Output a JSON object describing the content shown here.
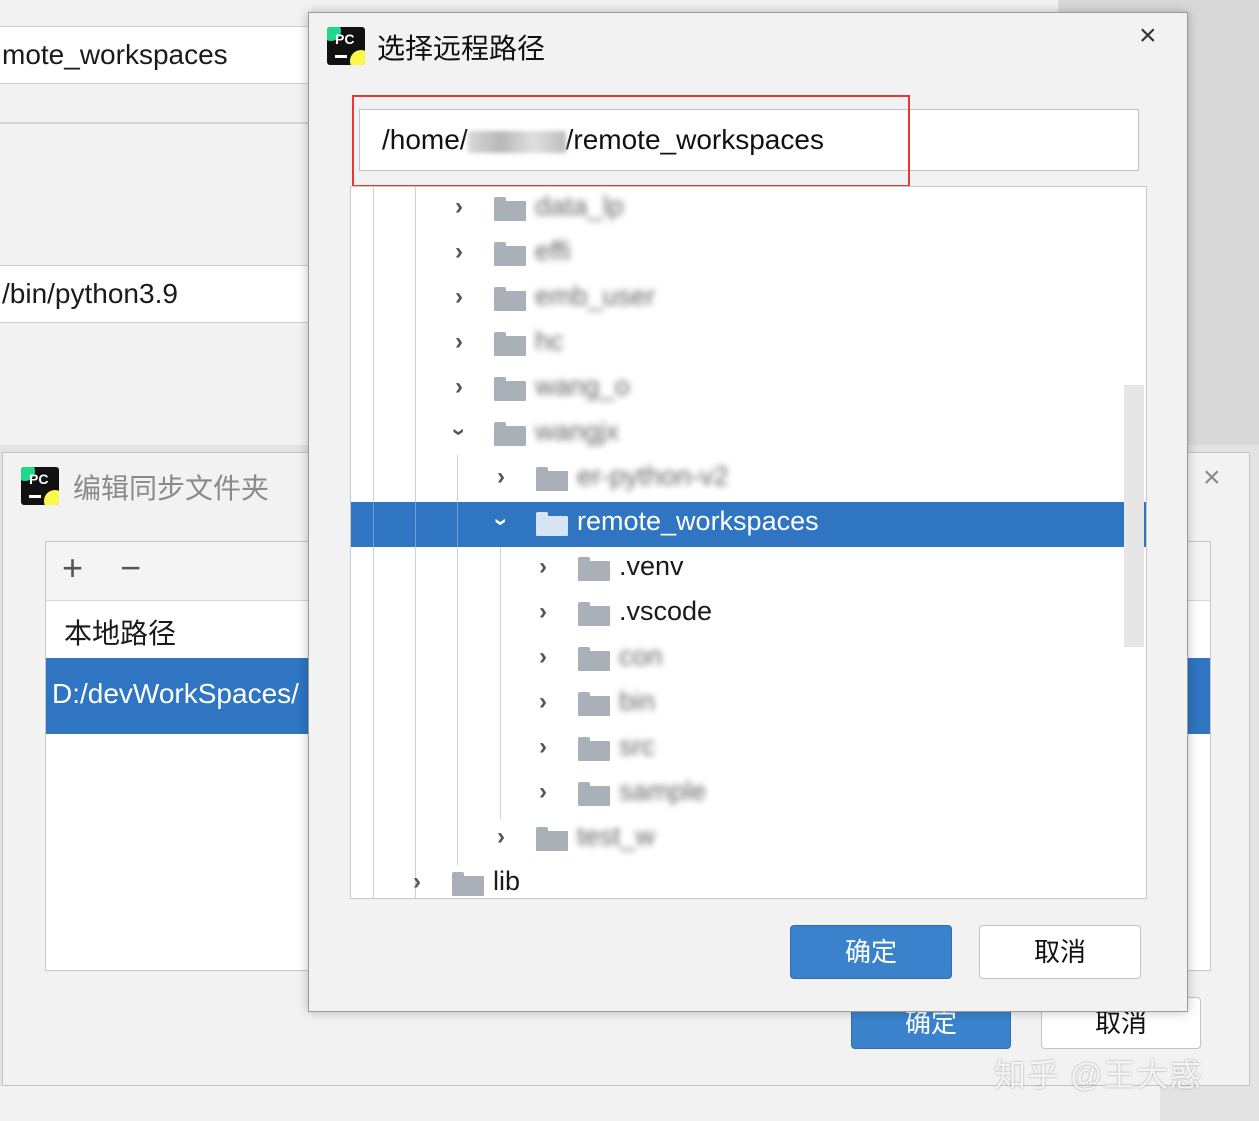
{
  "background_window": {
    "fields": [
      "mote_workspaces",
      "/bin/python3.9"
    ]
  },
  "sync_dialog": {
    "title": "编辑同步文件夹",
    "close": "×",
    "add": "+",
    "remove": "−",
    "column_header": "本地路径",
    "rows": [
      "D:/devWorkSpaces/"
    ],
    "ok": "确定",
    "cancel": "取消"
  },
  "remote_dialog": {
    "logo_text": "PC",
    "title": "选择远程路径",
    "close": "×",
    "path_prefix": "/home/",
    "path_suffix": "/remote_workspaces",
    "ok": "确定",
    "cancel": "取消"
  },
  "tree": {
    "items": [
      {
        "label": "data_lp",
        "obscured": true
      },
      {
        "label": "effi",
        "obscured": true
      },
      {
        "label": "emb_user",
        "obscured": true
      },
      {
        "label": "hc",
        "obscured": true
      },
      {
        "label": "wang_o",
        "obscured": true
      },
      {
        "label": "wangjx",
        "obscured": true
      },
      {
        "label": "er-python-v2",
        "obscured": true
      },
      {
        "label": "remote_workspaces",
        "obscured": false
      },
      {
        "label": ".venv",
        "obscured": false
      },
      {
        "label": ".vscode",
        "obscured": false
      },
      {
        "label": "con",
        "obscured": true
      },
      {
        "label": "bin",
        "obscured": true
      },
      {
        "label": "src",
        "obscured": true
      },
      {
        "label": "sample",
        "obscured": true
      },
      {
        "label": "test_w",
        "obscured": true
      },
      {
        "label": "lib",
        "obscured": false
      }
    ]
  },
  "watermark": "知乎 @王大惑"
}
